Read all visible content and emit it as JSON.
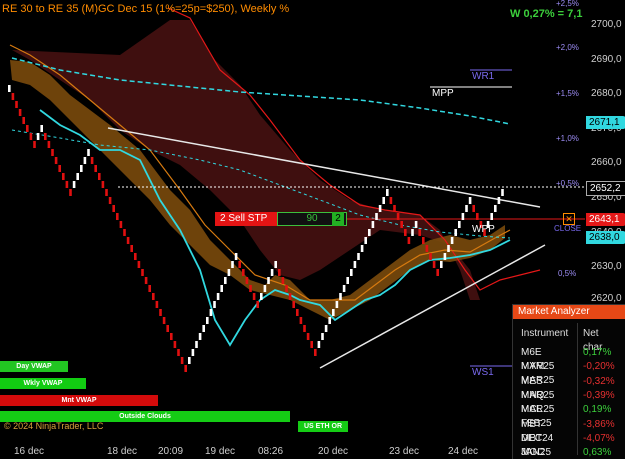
{
  "window": {
    "title": "RE 30 to RE 35 (M)GC Dec 15 (1%=25p=$250), Weekly %",
    "weekly_change": "W 0,27% = 7,1",
    "copyright": "© 2024 NinjaTrader, LLC"
  },
  "axis": {
    "prices": [
      "2700,0",
      "2690,0",
      "2680,0",
      "2670,0",
      "2660,0",
      "2650,0",
      "2640,0",
      "2630,0",
      "2620,0"
    ],
    "percents": [
      "+2,5%",
      "+2,0%",
      "+1,5%",
      "+1,0%",
      "+0,5%",
      "0,5%"
    ],
    "price_tags": {
      "current": "2652,2",
      "wr1_tag": "2671,1",
      "sell": "2643,1",
      "cyan": "2638,0"
    },
    "close_label": "CLOSE"
  },
  "levels": {
    "wr1": "WR1",
    "mpp": "MPP",
    "wpp": "WPP",
    "ws1": "WS1"
  },
  "order": {
    "label": "2 Sell STP",
    "qty": "90",
    "count": "2"
  },
  "indicator_bars": [
    {
      "label": "Day VWAP",
      "color": "#22c522"
    },
    {
      "label": "Wkly VWAP",
      "color": "#12cc12"
    },
    {
      "label": "Mnt VWAP",
      "color": "#d40b0b"
    },
    {
      "label": "Outside Clouds",
      "color": "#15cc15"
    },
    {
      "label": "US ETH OR",
      "color": "#15cc15"
    }
  ],
  "x_axis": {
    "dates": [
      "16 dec",
      "18 dec",
      "20:09",
      "19 dec",
      "08:26",
      "20 dec",
      "23 dec",
      "24 dec"
    ]
  },
  "market_analyzer": {
    "title": "Market Analyzer",
    "columns": [
      "Instrument",
      "Net char"
    ],
    "rows": [
      {
        "instrument": "M6E MAR25",
        "change": "0,17%",
        "positive": true
      },
      {
        "instrument": "MYM MAR25",
        "change": "-0,20%",
        "positive": false
      },
      {
        "instrument": "MES MAR25",
        "change": "-0,32%",
        "positive": false
      },
      {
        "instrument": "MNQ MAR25",
        "change": "-0,39%",
        "positive": false
      },
      {
        "instrument": "MCL FEB25",
        "change": "0,19%",
        "positive": true
      },
      {
        "instrument": "MBT DEC24",
        "change": "-3,86%",
        "positive": false
      },
      {
        "instrument": "MBT JAN25",
        "change": "-4,07%",
        "positive": false
      },
      {
        "instrument": "MGC FEB25",
        "change": "0,63%",
        "positive": true
      }
    ]
  },
  "colors": {
    "up_brick": "#ffffff",
    "down_brick": "#e01010",
    "cloud_orange": "#b06a10",
    "cloud_red": "#5a1414",
    "cyan_line": "#31d8e0",
    "accent_orange": "#ff8c00"
  }
}
